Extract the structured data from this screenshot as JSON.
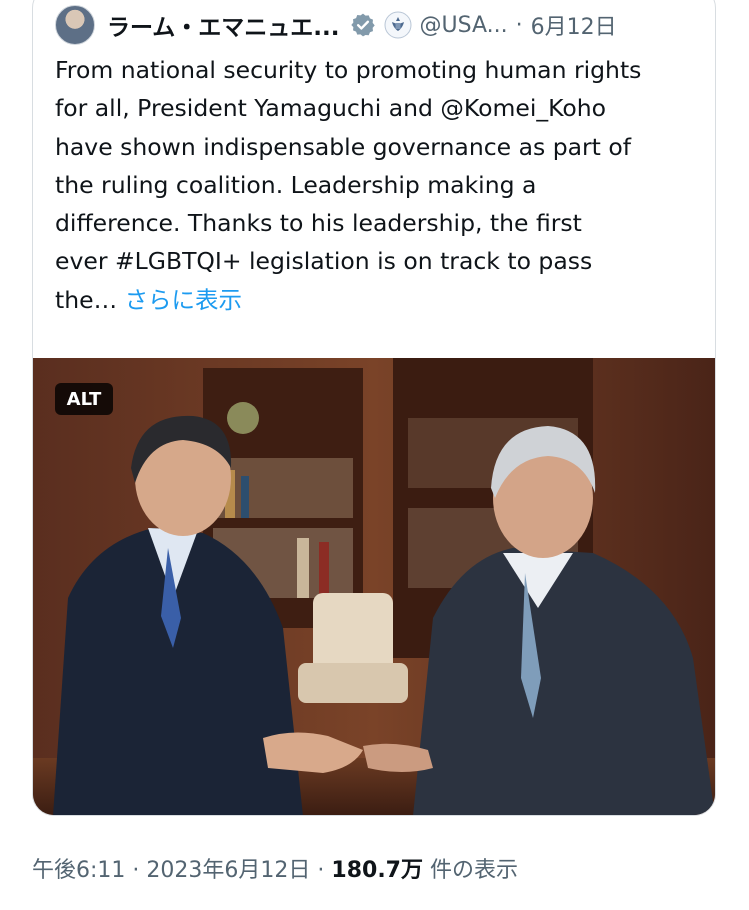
{
  "tweet": {
    "author_name": "ラーム・エマニュエ...",
    "handle": "@USA...",
    "separator": "·",
    "date": "6月12日",
    "lines": [
      "From national security to promoting human rights",
      "for all, President Yamaguchi and @Komei_Koho",
      "have shown indispensable governance as part of",
      "the ruling coalition. Leadership making a",
      "difference. Thanks to his leadership, the first",
      "ever #LGBTQI+ legislation is on track to pass",
      "the…"
    ],
    "show_more": "さらに表示",
    "alt_badge": "ALT"
  },
  "meta": {
    "time": "午後6:11",
    "sep1": "·",
    "date": "2023年6月12日",
    "sep2": "·",
    "views_count": "180.7万",
    "views_label": "件の表示"
  },
  "colors": {
    "link": "#1d9bf0",
    "muted": "#536471",
    "text": "#0f1419",
    "border": "#d8dde1"
  },
  "icons": [
    "avatar",
    "verified-badge-icon",
    "government-seal-icon"
  ]
}
